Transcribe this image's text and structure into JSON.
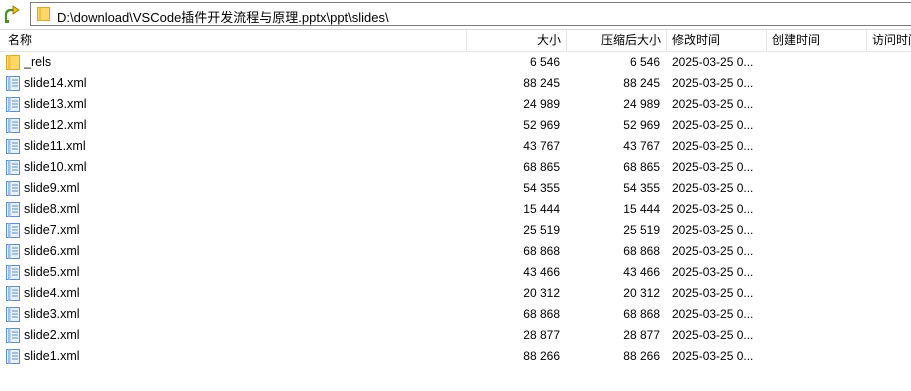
{
  "address": {
    "path": "D:\\download\\VSCode插件开发流程与原理.pptx\\ppt\\slides\\"
  },
  "columns": {
    "name": "名称",
    "size": "大小",
    "packed_size": "压缩后大小",
    "modified": "修改时间",
    "created": "创建时间",
    "accessed": "访问时间"
  },
  "files": [
    {
      "name": "_rels",
      "size": "6 546",
      "packed": "6 546",
      "modified": "2025-03-25 0...",
      "icon": "folder-icon"
    },
    {
      "name": "slide14.xml",
      "size": "88 245",
      "packed": "88 245",
      "modified": "2025-03-25 0...",
      "icon": "file-icon"
    },
    {
      "name": "slide13.xml",
      "size": "24 989",
      "packed": "24 989",
      "modified": "2025-03-25 0...",
      "icon": "file-icon"
    },
    {
      "name": "slide12.xml",
      "size": "52 969",
      "packed": "52 969",
      "modified": "2025-03-25 0...",
      "icon": "file-icon"
    },
    {
      "name": "slide11.xml",
      "size": "43 767",
      "packed": "43 767",
      "modified": "2025-03-25 0...",
      "icon": "file-icon"
    },
    {
      "name": "slide10.xml",
      "size": "68 865",
      "packed": "68 865",
      "modified": "2025-03-25 0...",
      "icon": "file-icon"
    },
    {
      "name": "slide9.xml",
      "size": "54 355",
      "packed": "54 355",
      "modified": "2025-03-25 0...",
      "icon": "file-icon"
    },
    {
      "name": "slide8.xml",
      "size": "15 444",
      "packed": "15 444",
      "modified": "2025-03-25 0...",
      "icon": "file-icon"
    },
    {
      "name": "slide7.xml",
      "size": "25 519",
      "packed": "25 519",
      "modified": "2025-03-25 0...",
      "icon": "file-icon"
    },
    {
      "name": "slide6.xml",
      "size": "68 868",
      "packed": "68 868",
      "modified": "2025-03-25 0...",
      "icon": "file-icon"
    },
    {
      "name": "slide5.xml",
      "size": "43 466",
      "packed": "43 466",
      "modified": "2025-03-25 0...",
      "icon": "file-icon"
    },
    {
      "name": "slide4.xml",
      "size": "20 312",
      "packed": "20 312",
      "modified": "2025-03-25 0...",
      "icon": "file-icon"
    },
    {
      "name": "slide3.xml",
      "size": "68 868",
      "packed": "68 868",
      "modified": "2025-03-25 0...",
      "icon": "file-icon"
    },
    {
      "name": "slide2.xml",
      "size": "28 877",
      "packed": "28 877",
      "modified": "2025-03-25 0...",
      "icon": "file-icon"
    },
    {
      "name": "slide1.xml",
      "size": "88 266",
      "packed": "88 266",
      "modified": "2025-03-25 0...",
      "icon": "file-icon"
    }
  ],
  "colors": {
    "folder": "#ffd766",
    "file_icon": "#5f8fc7",
    "border": "#e5e5e5"
  }
}
